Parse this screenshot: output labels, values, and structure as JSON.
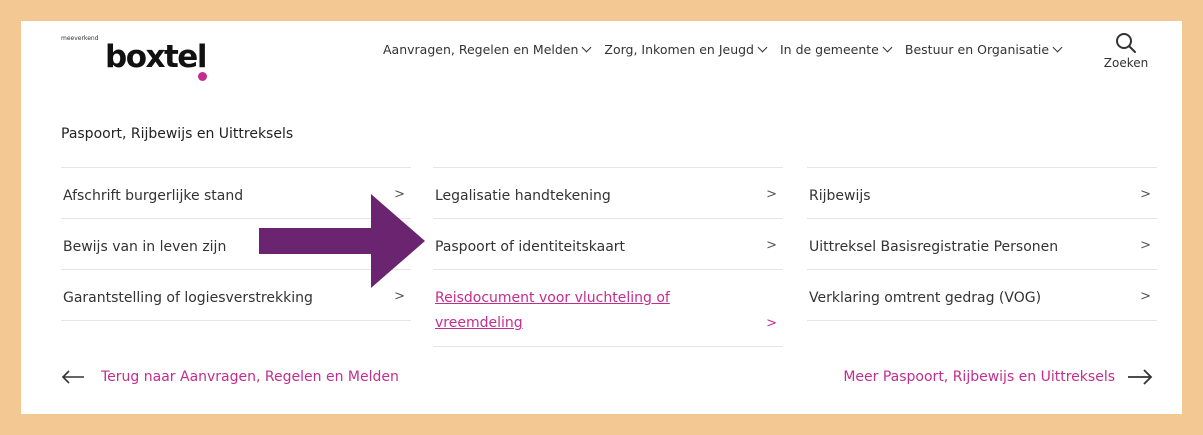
{
  "header": {
    "logo_small": "meeverkend",
    "logo_text": "boxtel",
    "nav": [
      "Aanvragen, Regelen en Melden",
      "Zorg, Inkomen en Jeugd",
      "In de gemeente",
      "Bestuur en Organisatie"
    ],
    "search_label": "Zoeken"
  },
  "section_title": "Paspoort, Rijbewijs en Uittreksels",
  "columns": [
    [
      {
        "label": "Afschrift burgerlijke stand",
        "arrow": ">"
      },
      {
        "label": "Bewijs van in leven zijn",
        "arrow": ">"
      },
      {
        "label": "Garantstelling of logiesverstrekking",
        "arrow": ">"
      }
    ],
    [
      {
        "label": "Legalisatie handtekening",
        "arrow": ">"
      },
      {
        "label": "Paspoort of identiteitskaart",
        "arrow": ">"
      },
      {
        "label": "Reisdocument voor vluchteling of vreemdeling",
        "arrow": ">"
      }
    ],
    [
      {
        "label": "Rijbewijs",
        "arrow": ">"
      },
      {
        "label": "Uittreksel Basisregistratie Personen",
        "arrow": ">"
      },
      {
        "label": "Verklaring omtrent gedrag (VOG)",
        "arrow": ">"
      }
    ]
  ],
  "footer": {
    "back_label": "Terug naar Aanvragen, Regelen en Melden",
    "more_label": "Meer Paspoort, Rijbewijs en Uittreksels"
  },
  "colors": {
    "accent": "#c22d8f",
    "annotation_arrow": "#6b2470",
    "frame": "#f3c892"
  }
}
